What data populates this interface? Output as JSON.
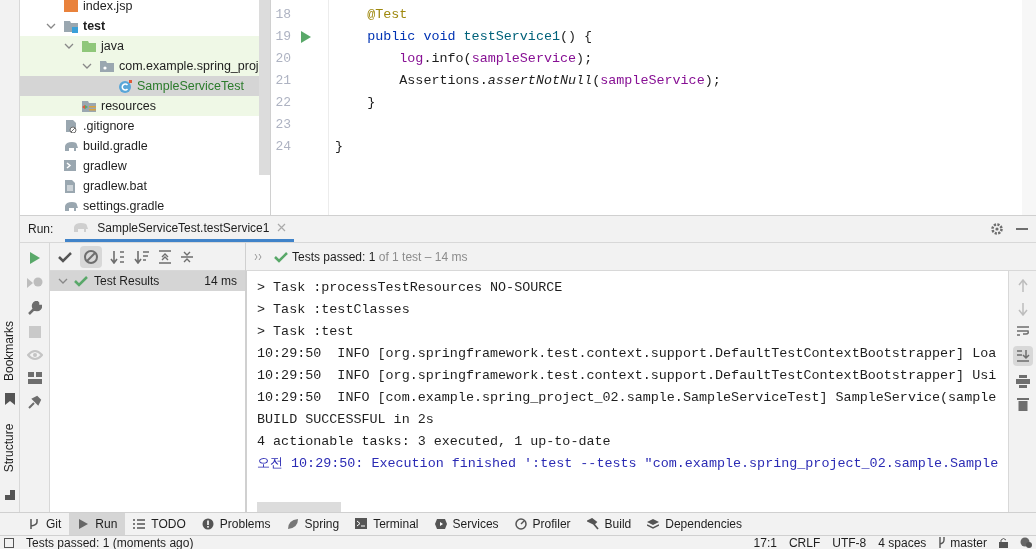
{
  "side_labels": [
    "Bookmarks",
    "Structure"
  ],
  "project_tree": [
    {
      "label": "index.jsp",
      "kind": "jsp"
    },
    {
      "label": "test",
      "kind": "folder",
      "bold": true,
      "expanded": true,
      "children": [
        {
          "label": "java",
          "kind": "test-folder",
          "expanded": true,
          "test_source": true,
          "children": [
            {
              "label": "com.example.spring_proj",
              "kind": "package",
              "expanded": true,
              "children": [
                {
                  "label": "SampleServiceTest",
                  "kind": "test-class",
                  "selected": true
                }
              ]
            }
          ]
        },
        {
          "label": "resources",
          "kind": "resources",
          "test_source": true
        }
      ]
    },
    {
      "label": ".gitignore",
      "kind": "ignore"
    },
    {
      "label": "build.gradle",
      "kind": "gradle"
    },
    {
      "label": "gradlew",
      "kind": "script"
    },
    {
      "label": "gradlew.bat",
      "kind": "text"
    },
    {
      "label": "settings.gradle",
      "kind": "gradle"
    }
  ],
  "editor": {
    "lines": [
      {
        "number": "18",
        "tokens": [
          {
            "text": "    @Test",
            "kind": "annotation"
          }
        ]
      },
      {
        "number": "19",
        "run_marker": true,
        "tokens": [
          {
            "text": "    public void ",
            "kind": "keyword"
          },
          {
            "text": "testService1",
            "kind": "declaration"
          },
          {
            "text": "() {"
          }
        ]
      },
      {
        "number": "20",
        "tokens": [
          {
            "text": "        log",
            "kind": "field"
          },
          {
            "text": ".info("
          },
          {
            "text": "sampleService",
            "kind": "field"
          },
          {
            "text": ");"
          }
        ]
      },
      {
        "number": "21",
        "tokens": [
          {
            "text": "        Assertions."
          },
          {
            "text": "assertNotNull",
            "kind": "static"
          },
          {
            "text": "("
          },
          {
            "text": "sampleService",
            "kind": "field"
          },
          {
            "text": ");"
          }
        ]
      },
      {
        "number": "22",
        "tokens": [
          {
            "text": "    }"
          }
        ]
      },
      {
        "number": "23"
      },
      {
        "number": "24",
        "tokens": [
          {
            "text": "}"
          }
        ]
      }
    ]
  },
  "run": {
    "label": "Run:",
    "tab": "SampleServiceTest.testService1",
    "summary": {
      "label": "Tests passed:",
      "passed": "1",
      "rest": "of 1 test – 14 ms"
    },
    "results": [
      {
        "label": "Test Results",
        "time": "14 ms",
        "expanded": true,
        "selected": true
      }
    ],
    "console": [
      {
        "text": "> Task :processTestResources NO-SOURCE"
      },
      {
        "text": "> Task :testClasses"
      },
      {
        "text": "> Task :test"
      },
      {
        "text": "10:29:50  INFO [org.springframework.test.context.support.DefaultTestContextBootstrapper] Loa"
      },
      {
        "text": "10:29:50  INFO [org.springframework.test.context.support.DefaultTestContextBootstrapper] Usi"
      },
      {
        "text": "10:29:50  INFO [com.example.spring_project_02.sample.SampleServiceTest] SampleService(sample"
      },
      {
        "text": "BUILD SUCCESSFUL in 2s"
      },
      {
        "text": "4 actionable tasks: 3 executed, 1 up-to-date"
      },
      {
        "text": "오전 10:29:50: Execution finished ':test --tests \"com.example.spring_project_02.sample.Sample",
        "kind": "system"
      }
    ]
  },
  "tool_windows": [
    {
      "label": "Git",
      "selected": false
    },
    {
      "label": "Run",
      "selected": true
    },
    {
      "label": "TODO",
      "selected": false
    },
    {
      "label": "Problems",
      "selected": false
    },
    {
      "label": "Spring",
      "selected": false
    },
    {
      "label": "Terminal",
      "selected": false
    },
    {
      "label": "Services",
      "selected": false
    },
    {
      "label": "Profiler",
      "selected": false
    },
    {
      "label": "Build",
      "selected": false
    },
    {
      "label": "Dependencies",
      "selected": false
    }
  ],
  "status_bar": {
    "message": "Tests passed: 1 (moments ago)",
    "items": [
      "17:1",
      "CRLF",
      "UTF-8",
      "4 spaces"
    ],
    "branch": "master"
  }
}
